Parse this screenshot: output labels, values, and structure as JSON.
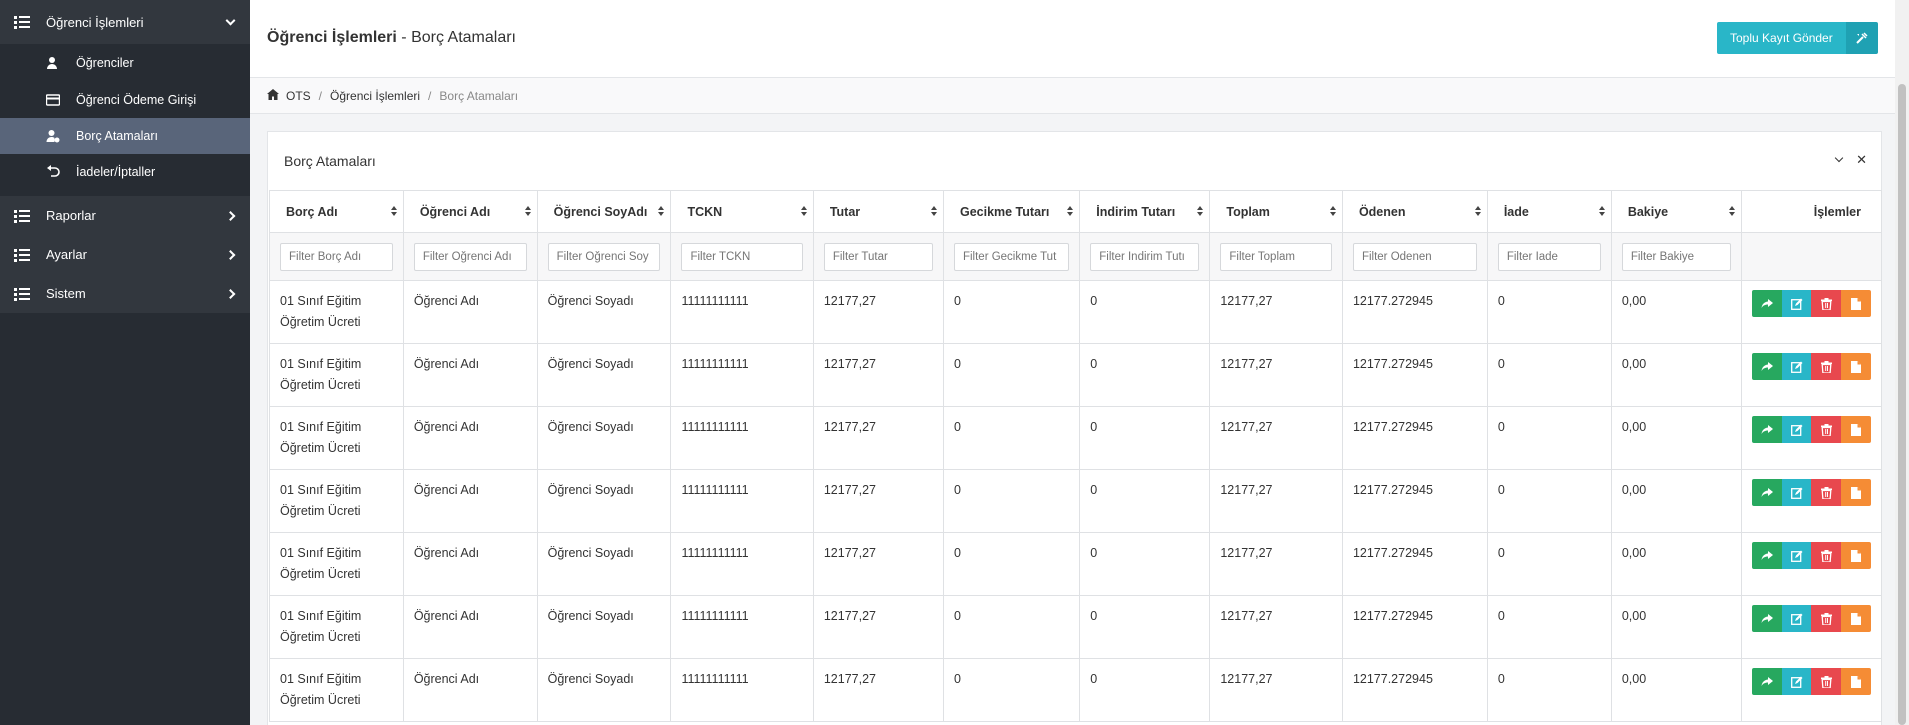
{
  "sidebar": {
    "groups": [
      {
        "label": "Öğrenci İşlemleri",
        "icon": "list-icon",
        "expanded": true
      },
      {
        "label": "Raporlar",
        "icon": "list-icon",
        "expanded": false
      },
      {
        "label": "Ayarlar",
        "icon": "list-icon",
        "expanded": false
      },
      {
        "label": "Sistem",
        "icon": "list-icon",
        "expanded": false
      }
    ],
    "sub_items": [
      {
        "label": "Öğrenciler",
        "icon": "user-icon"
      },
      {
        "label": "Öğrenci Ödeme Girişi",
        "icon": "credit-card-icon"
      },
      {
        "label": "Borç Atamaları",
        "icon": "user-money-icon",
        "active": true
      },
      {
        "label": "İadeler/İptaller",
        "icon": "undo-icon"
      }
    ]
  },
  "header": {
    "title_bold": "Öğrenci İşlemleri",
    "title_rest": " - Borç Atamaları",
    "bulk_button": "Toplu Kayıt Gönder"
  },
  "breadcrumb": {
    "home": "OTS",
    "parent": "Öğrenci İşlemleri",
    "current": "Borç Atamaları"
  },
  "card": {
    "title": "Borç Atamaları"
  },
  "table": {
    "columns": [
      "Borç Adı",
      "Öğrenci Adı",
      "Öğrenci SoyAdı",
      "TCKN",
      "Tutar",
      "Gecikme Tutarı",
      "İndirim Tutarı",
      "Toplam",
      "Ödenen",
      "İade",
      "Bakiye",
      "İşlemler"
    ],
    "filters": [
      "Filter Borç Adı",
      "Filter Öğrenci Adı",
      "Filter Öğrenci Soy",
      "Filter TCKN",
      "Filter Tutar",
      "Filter Gecikme Tut",
      "Filter İndirim Tutı",
      "Filter Toplam",
      "Filter Ödenen",
      "Filter İade",
      "Filter Bakiye"
    ],
    "rows": [
      {
        "borc_adi_1": "01 Sınıf Eğitim",
        "borc_adi_2": "Öğretim Ücreti",
        "ad": "Öğrenci Adı",
        "soyad": "Öğrenci Soyadı",
        "tckn": "11111111111",
        "tutar": "12177,27",
        "gecikme": "0",
        "indirim": "0",
        "toplam": "12177,27",
        "odenen": "12177.272945",
        "iade": "0",
        "bakiye": "0,00"
      },
      {
        "borc_adi_1": "01 Sınıf Eğitim",
        "borc_adi_2": "Öğretim Ücreti",
        "ad": "Öğrenci Adı",
        "soyad": "Öğrenci Soyadı",
        "tckn": "11111111111",
        "tutar": "12177,27",
        "gecikme": "0",
        "indirim": "0",
        "toplam": "12177,27",
        "odenen": "12177.272945",
        "iade": "0",
        "bakiye": "0,00"
      },
      {
        "borc_adi_1": "01 Sınıf Eğitim",
        "borc_adi_2": "Öğretim Ücreti",
        "ad": "Öğrenci Adı",
        "soyad": "Öğrenci Soyadı",
        "tckn": "11111111111",
        "tutar": "12177,27",
        "gecikme": "0",
        "indirim": "0",
        "toplam": "12177,27",
        "odenen": "12177.272945",
        "iade": "0",
        "bakiye": "0,00"
      },
      {
        "borc_adi_1": "01 Sınıf Eğitim",
        "borc_adi_2": "Öğretim Ücreti",
        "ad": "Öğrenci Adı",
        "soyad": "Öğrenci Soyadı",
        "tckn": "11111111111",
        "tutar": "12177,27",
        "gecikme": "0",
        "indirim": "0",
        "toplam": "12177,27",
        "odenen": "12177.272945",
        "iade": "0",
        "bakiye": "0,00"
      },
      {
        "borc_adi_1": "01 Sınıf Eğitim",
        "borc_adi_2": "Öğretim Ücreti",
        "ad": "Öğrenci Adı",
        "soyad": "Öğrenci Soyadı",
        "tckn": "11111111111",
        "tutar": "12177,27",
        "gecikme": "0",
        "indirim": "0",
        "toplam": "12177,27",
        "odenen": "12177.272945",
        "iade": "0",
        "bakiye": "0,00"
      },
      {
        "borc_adi_1": "01 Sınıf Eğitim",
        "borc_adi_2": "Öğretim Ücreti",
        "ad": "Öğrenci Adı",
        "soyad": "Öğrenci Soyadı",
        "tckn": "11111111111",
        "tutar": "12177,27",
        "gecikme": "0",
        "indirim": "0",
        "toplam": "12177,27",
        "odenen": "12177.272945",
        "iade": "0",
        "bakiye": "0,00"
      },
      {
        "borc_adi_1": "01 Sınıf Eğitim",
        "borc_adi_2": "Öğretim Ücreti",
        "ad": "Öğrenci Adı",
        "soyad": "Öğrenci Soyadı",
        "tckn": "11111111111",
        "tutar": "12177,27",
        "gecikme": "0",
        "indirim": "0",
        "toplam": "12177,27",
        "odenen": "12177.272945",
        "iade": "0",
        "bakiye": "0,00"
      }
    ]
  },
  "colors": {
    "sidebar_bg": "#272c33",
    "active_item": "#59657a",
    "accent_teal": "#29b6c8",
    "green": "#27a85f",
    "red": "#e8484e",
    "orange": "#f58c35"
  }
}
